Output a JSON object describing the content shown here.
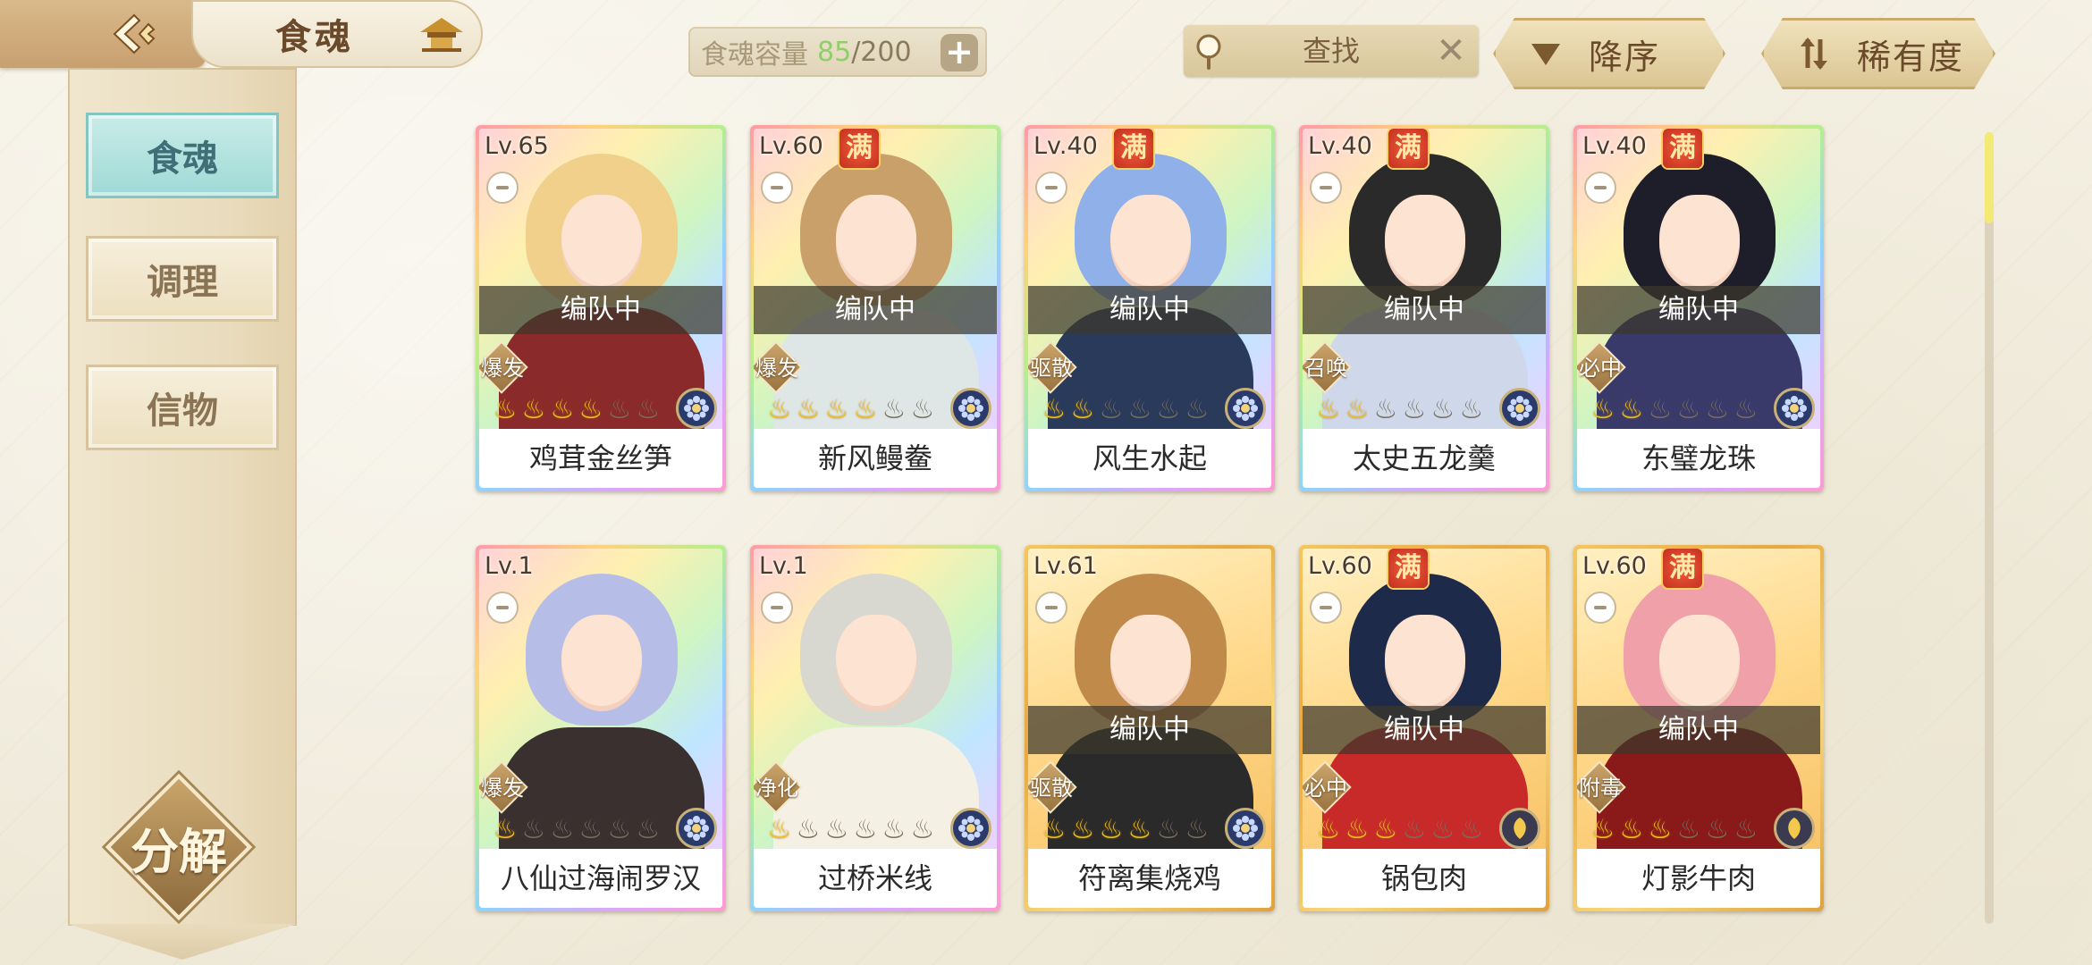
{
  "header": {
    "title": "食魂",
    "capacity_label": "食魂容量",
    "capacity_current": "85",
    "capacity_sep": "/",
    "capacity_max": "200",
    "search_placeholder": "查找",
    "sort_order_label": "降序",
    "sort_rarity_label": "稀有度",
    "icons": [
      "back-arrow-icon",
      "pagoda-icon",
      "plus-icon",
      "magnifier-icon",
      "close-icon",
      "triangle-down-icon",
      "swap-arrows-icon"
    ]
  },
  "sidebar": {
    "items": [
      {
        "label": "食魂",
        "active": true
      },
      {
        "label": "调理",
        "active": false
      },
      {
        "label": "信物",
        "active": false
      }
    ],
    "decompose_label": "分解"
  },
  "colors": {
    "accent_teal": "#9fd9d6",
    "capacity_green": "#8fcf6a",
    "full_badge_red": "#c23020",
    "star_gold": "#f2c020"
  },
  "cards": [
    {
      "level": "Lv.65",
      "full": false,
      "full_label": "",
      "status": "编队中",
      "role": "爆发",
      "stars_on": 4,
      "name": "鸡茸金丝笋",
      "frame": "rainbow",
      "hair": "#f0d08a",
      "body": "#8a2a2a",
      "element": "flower-icon"
    },
    {
      "level": "Lv.60",
      "full": true,
      "full_label": "满",
      "status": "编队中",
      "role": "爆发",
      "stars_on": 4,
      "name": "新风鳗鲞",
      "frame": "rainbow",
      "hair": "#c9a06a",
      "body": "#dfe7e6",
      "element": "flower-icon"
    },
    {
      "level": "Lv.40",
      "full": true,
      "full_label": "满",
      "status": "编队中",
      "role": "驱散",
      "stars_on": 2,
      "name": "风生水起",
      "frame": "rainbow",
      "hair": "#8fb0e8",
      "body": "#2a3a5a",
      "element": "flower-icon"
    },
    {
      "level": "Lv.40",
      "full": true,
      "full_label": "满",
      "status": "编队中",
      "role": "召唤",
      "stars_on": 2,
      "name": "太史五龙羹",
      "frame": "rainbow",
      "hair": "#2a2a2a",
      "body": "#cfd8ea",
      "element": "flower-icon"
    },
    {
      "level": "Lv.40",
      "full": true,
      "full_label": "满",
      "status": "编队中",
      "role": "必中",
      "stars_on": 2,
      "name": "东璧龙珠",
      "frame": "rainbow",
      "hair": "#1e1e2a",
      "body": "#3a3a6a",
      "element": "flower-icon"
    },
    {
      "level": "Lv.1",
      "full": false,
      "full_label": "",
      "status": "",
      "role": "爆发",
      "stars_on": 1,
      "name": "八仙过海闹罗汉",
      "frame": "rainbow",
      "hair": "#b6bde6",
      "body": "#3a3030",
      "element": "flower-icon"
    },
    {
      "level": "Lv.1",
      "full": false,
      "full_label": "",
      "status": "",
      "role": "净化",
      "stars_on": 1,
      "name": "过桥米线",
      "frame": "rainbow",
      "hair": "#d8d8d0",
      "body": "#f4f0e4",
      "element": "flower-icon"
    },
    {
      "level": "Lv.61",
      "full": false,
      "full_label": "",
      "status": "编队中",
      "role": "驱散",
      "stars_on": 4,
      "name": "符离集烧鸡",
      "frame": "gold",
      "hair": "#c08a4a",
      "body": "#2a2a2a",
      "element": "flower-icon"
    },
    {
      "level": "Lv.60",
      "full": true,
      "full_label": "满",
      "status": "编队中",
      "role": "必中",
      "stars_on": 3,
      "name": "锅包肉",
      "frame": "gold",
      "hair": "#1e2a4a",
      "body": "#c82a2a",
      "element": "leaf-icon"
    },
    {
      "level": "Lv.60",
      "full": true,
      "full_label": "满",
      "status": "编队中",
      "role": "附毒",
      "stars_on": 3,
      "name": "灯影牛肉",
      "frame": "gold",
      "hair": "#f0a0a8",
      "body": "#8a1a1a",
      "element": "leaf-icon"
    }
  ],
  "scroll": {
    "position": 0.0
  }
}
